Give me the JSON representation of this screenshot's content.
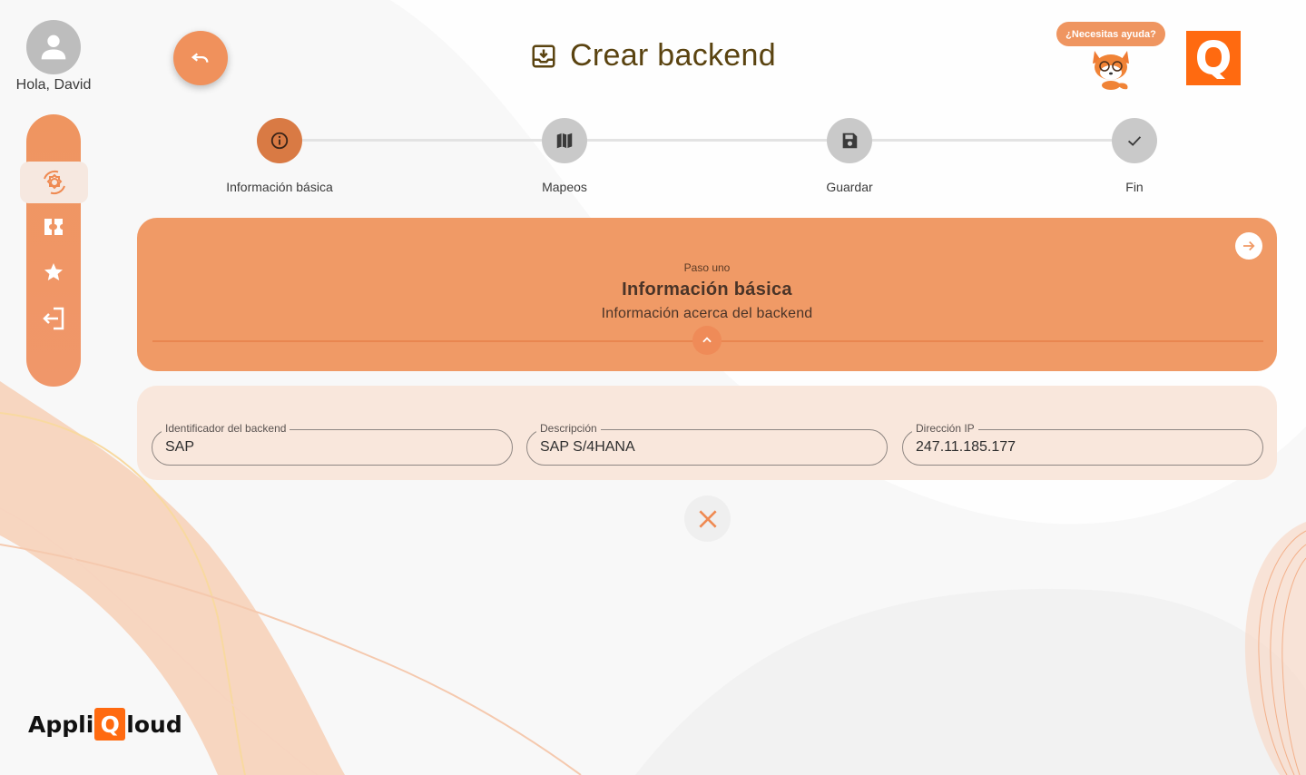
{
  "user": {
    "greeting": "Hola, David"
  },
  "header": {
    "title": "Crear backend",
    "help_label": "¿Necesitas ayuda?"
  },
  "sidebar": {
    "items": [
      {
        "icon": "settings-sync-icon",
        "active": true
      },
      {
        "icon": "ticket-icon",
        "active": false
      },
      {
        "icon": "star-icon",
        "active": false
      },
      {
        "icon": "logout-icon",
        "active": false
      }
    ]
  },
  "stepper": {
    "steps": [
      {
        "label": "Información básica",
        "icon": "info-icon",
        "active": true
      },
      {
        "label": "Mapeos",
        "icon": "map-icon",
        "active": false
      },
      {
        "label": "Guardar",
        "icon": "save-icon",
        "active": false
      },
      {
        "label": "Fin",
        "icon": "check-icon",
        "active": false
      }
    ]
  },
  "step_card": {
    "subtitle": "Paso uno",
    "title": "Información básica",
    "description": "Información acerca del backend"
  },
  "form": {
    "backend_id": {
      "label": "Identificador del backend",
      "value": "SAP"
    },
    "description": {
      "label": "Descripción",
      "value": "SAP S/4HANA"
    },
    "ip": {
      "label": "Dirección IP",
      "value": "247.11.185.177"
    }
  },
  "brand": {
    "prefix": "Appli",
    "q": "Q",
    "suffix": "loud"
  },
  "colors": {
    "accent": "#f09a66",
    "accent_dark": "#d97a44",
    "logo": "#ff6a10",
    "title": "#5a4310"
  }
}
